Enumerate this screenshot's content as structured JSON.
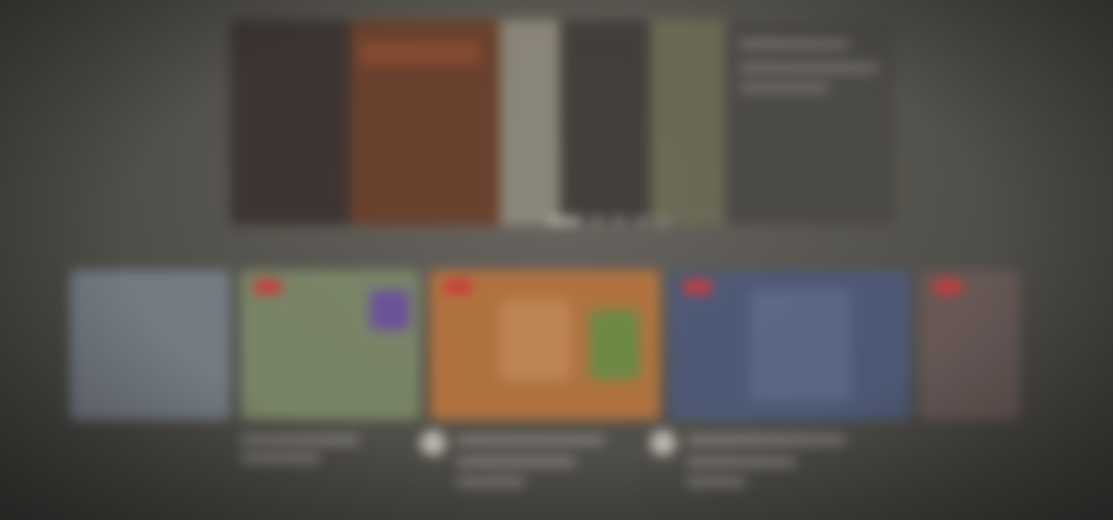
{
  "hero": {
    "slides_total": 5,
    "active_slide": 1
  },
  "tiles": [
    {
      "live": false,
      "accent": "#7d8a6a"
    },
    {
      "live": true,
      "accent": "#9aa06a"
    },
    {
      "live": true,
      "accent": "#b9763e"
    },
    {
      "live": true,
      "accent": "#4d5a7a"
    }
  ],
  "colors": {
    "live_badge": "#d8383a",
    "background": "#57554f"
  }
}
